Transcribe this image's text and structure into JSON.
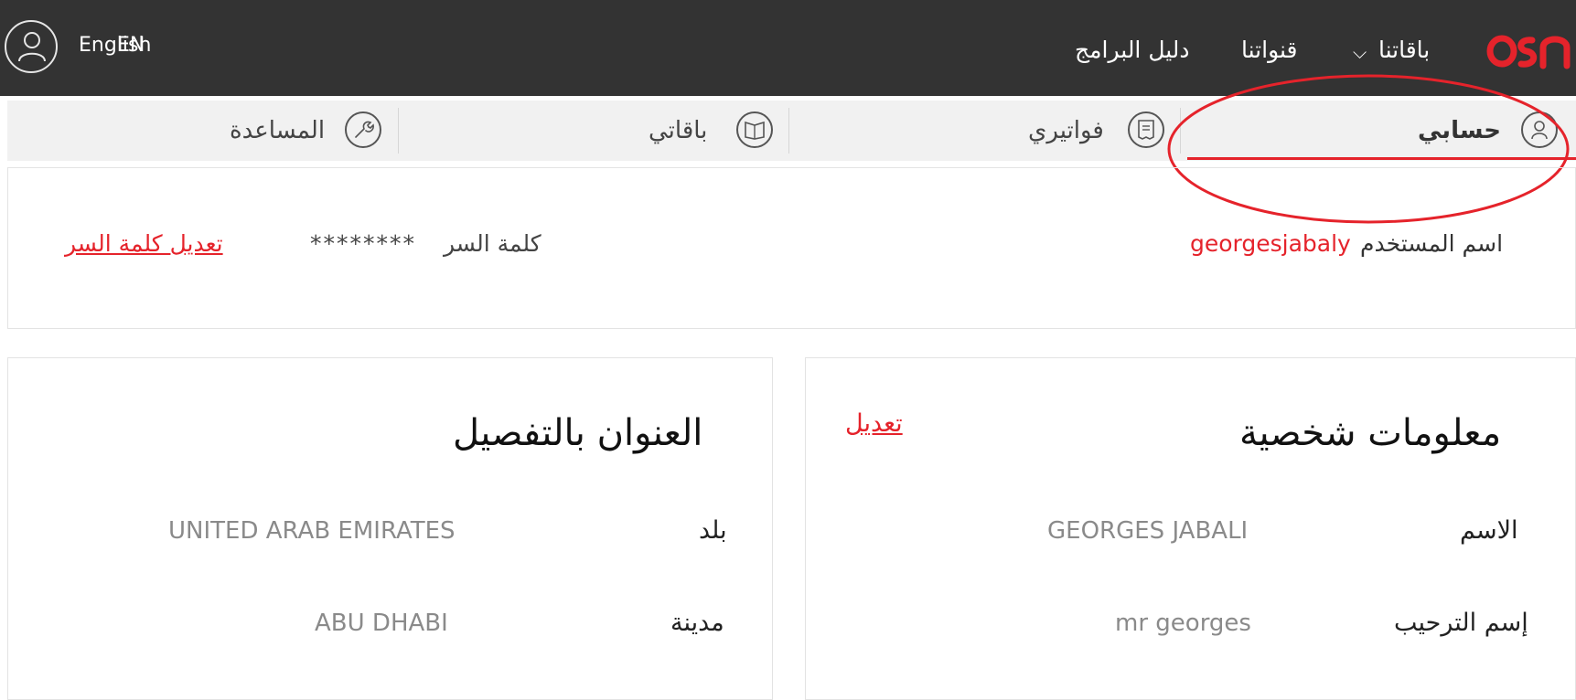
{
  "header": {
    "nav": {
      "guide": "دليل البرامج",
      "channels": "قنواتنا",
      "packages": "باقاتنا"
    },
    "language": "English",
    "language_overlay": "EN",
    "logo_alt": "osn"
  },
  "tabs": {
    "account": "حسابي",
    "bills": "فواتيري",
    "packages": "باقاتي",
    "help": "المساعدة"
  },
  "credentials": {
    "username_label": "اسم المستخدم",
    "username_value": "georgesjabaly",
    "password_label": "كلمة السر",
    "password_value": "********",
    "edit_password": "تعديل كلمة السر"
  },
  "personal": {
    "title": "معلومات شخصية",
    "edit": "تعديل",
    "name_label": "الاسم",
    "name_value": "GEORGES JABALI",
    "greeting_label": "إسم الترحيب",
    "greeting_value": "mr georges"
  },
  "address": {
    "title": "العنوان بالتفصيل",
    "country_label": "بلد",
    "country_value": "UNITED ARAB EMIRATES",
    "city_label": "مدينة",
    "city_value": "ABU DHABI"
  },
  "colors": {
    "topbar": "#333333",
    "accent": "#e5232b",
    "tabs_bg": "#f1f1f1"
  },
  "icons": [
    "user-icon",
    "chevron-down-icon",
    "osn-logo",
    "profile-icon",
    "bill-icon",
    "book-icon",
    "wrench-icon"
  ]
}
